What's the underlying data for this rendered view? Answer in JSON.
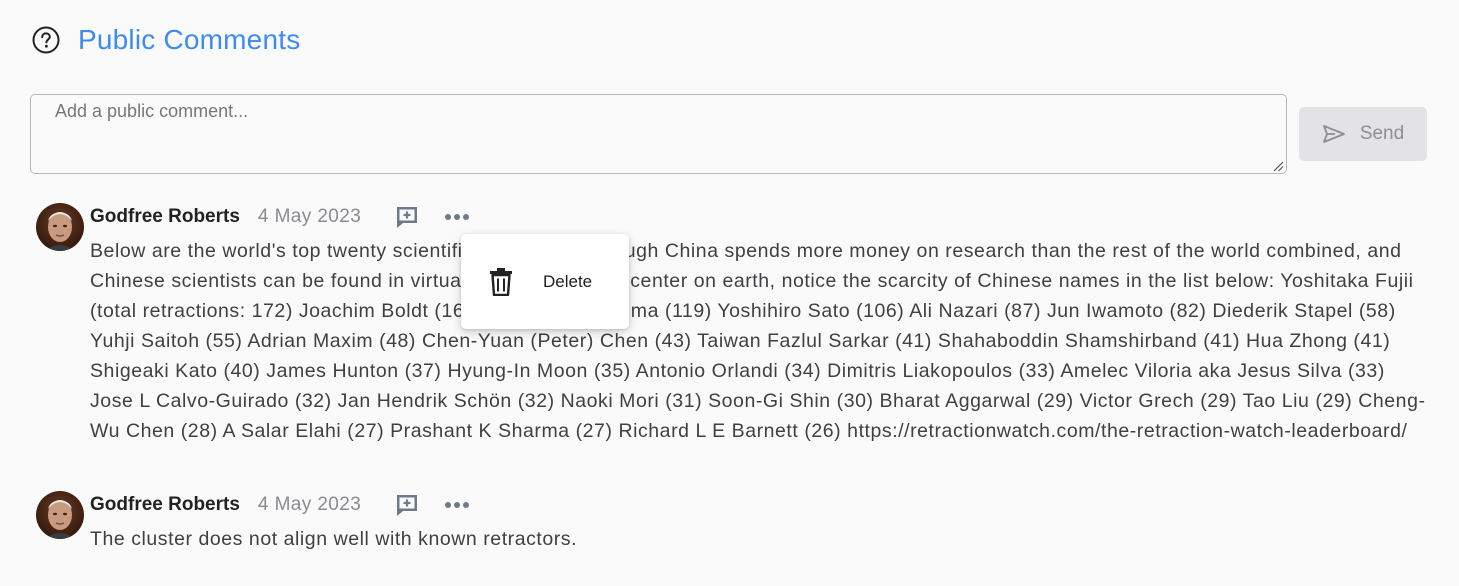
{
  "header": {
    "title": "Public Comments",
    "help_icon": "help-circle-icon"
  },
  "composer": {
    "placeholder": "Add a public comment...",
    "value": "",
    "send_label": "Send",
    "send_icon": "paper-plane-icon"
  },
  "comments": [
    {
      "author": "Godfree Roberts",
      "date": "4 May 2023",
      "text": "Below are the world's top twenty scientific retractors. Although China spends more money on research than the rest of the world combined, and Chinese scientists can be found in virtually every research center on earth, notice the scarcity of Chinese names in the list below: Yoshitaka Fujii (total retractions: 172) Joachim Boldt (163) Hironobu Ueshima (119) Yoshihiro Sato (106) Ali Nazari (87) Jun Iwamoto (82) Diederik Stapel (58) Yuhji Saitoh (55) Adrian Maxim (48) Chen-Yuan (Peter) Chen (43) Taiwan Fazlul Sarkar (41) Shahaboddin Shamshirband (41) Hua Zhong (41) Shigeaki Kato (40) James Hunton (37) Hyung-In Moon (35) Antonio Orlandi (34) Dimitris Liakopoulos (33) Amelec Viloria aka Jesus Silva (33) Jose L Calvo-Guirado (32) Jan Hendrik Schön (32) Naoki Mori (31) Soon-Gi Shin (30) Bharat Aggarwal (29) Victor Grech (29) Tao Liu (29) Cheng-Wu Chen (28) A Salar Elahi (27) Prashant K Sharma (27) Richard L E Barnett (26) https://retractionwatch.com/the-retraction-watch-leaderboard/"
    },
    {
      "author": "Godfree Roberts",
      "date": "4 May 2023",
      "text": "The cluster does not align well with known retractors."
    }
  ],
  "context_menu": {
    "items": [
      {
        "label": "Delete",
        "icon": "trash-icon"
      }
    ]
  },
  "colors": {
    "accent": "#3d8bf2",
    "text": "#404044",
    "muted": "#8a8a90",
    "send_disabled_bg": "#e3e3e5"
  }
}
